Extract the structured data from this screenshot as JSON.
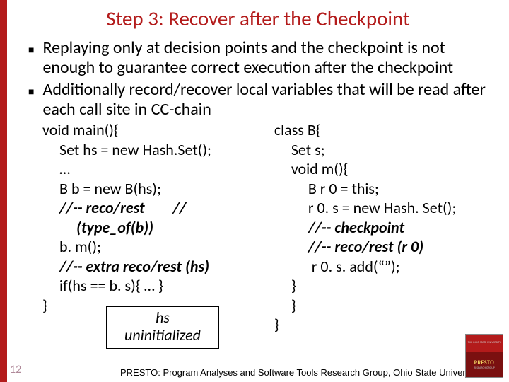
{
  "title": "Step 3: Recover after the Checkpoint",
  "bullets": {
    "b1": "Replaying only at decision points and the checkpoint is not enough to guarantee correct execution after the checkpoint",
    "b2": "Additionally  record/recover local variables that will be read after each call site in CC-chain"
  },
  "code_left": {
    "l1": "void main(){",
    "l2": "Set hs = new Hash.Set();",
    "l3": "…",
    "l4": "B b = new B(hs);",
    "l5a": "//-- reco/rest        //",
    "l5b": "(type_of(b))",
    "l6": "b. m();",
    "l7": "//-- extra reco/rest (hs)",
    "l8": "if(hs == b. s){ … }",
    "l9": "}"
  },
  "code_right": {
    "r1": "class B{",
    "r2": "Set s;",
    "r3": "void m(){",
    "r4": "B r 0 = this;",
    "r5": "r 0. s = new Hash. Set();",
    "r6": "//-- checkpoint",
    "r7": "//-- reco/rest (r 0)",
    "r8": " r 0. s. add(“”);",
    "r9": "}",
    "r10": "}",
    "r11": "}"
  },
  "hsbox": {
    "l1": "hs",
    "l2": "uninitialized"
  },
  "pagenum": "12",
  "footer": "PRESTO: Program Analyses and Software Tools Research Group, Ohio State University",
  "logo": {
    "top": "THE OHIO STATE UNIVERSITY",
    "p": "PRESTO",
    "g": "RESEARCH GROUP"
  }
}
